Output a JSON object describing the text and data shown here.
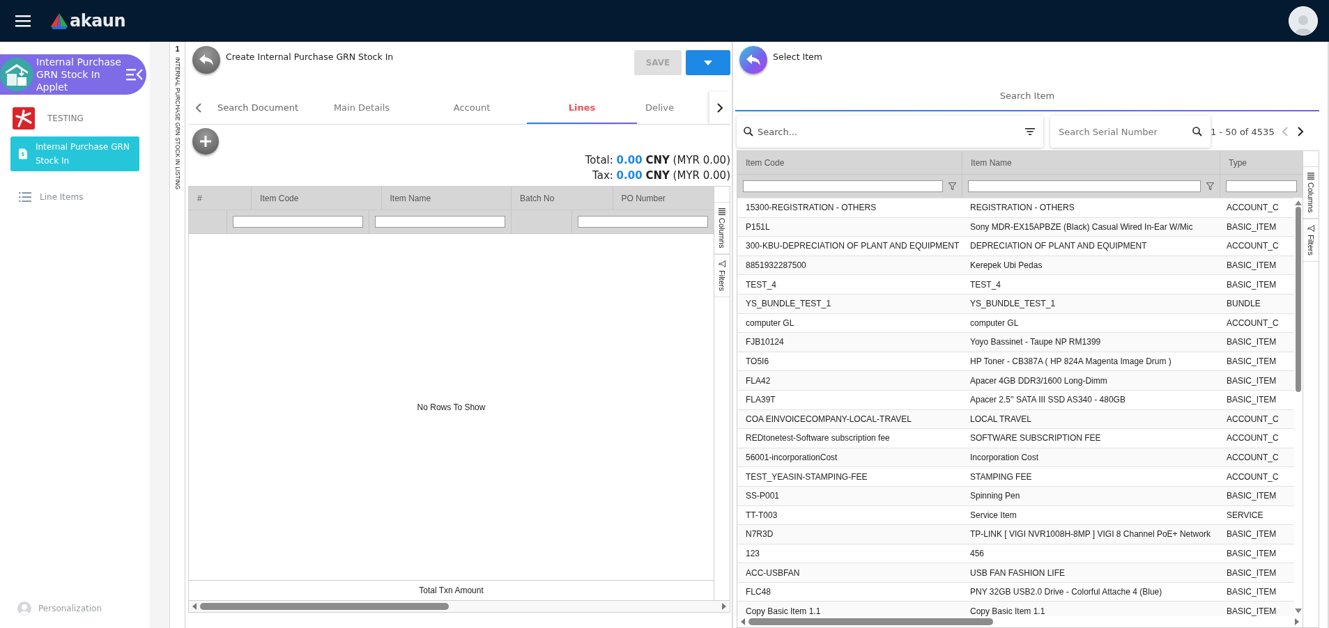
{
  "top_bar": {
    "logo_text": "akaun"
  },
  "sidebar": {
    "applet_title": "Internal Purchase GRN Stock In Applet",
    "org": "TESTING",
    "items": [
      {
        "label": "Internal Purchase GRN Stock In",
        "kind": "page",
        "selected": true
      },
      {
        "label": "Line Items",
        "kind": "list",
        "selected": false
      }
    ],
    "footer": "Personalization"
  },
  "listing_tab": {
    "count": "1",
    "label": "INTERNAL PURCHASE GRN STOCK IN LISTING"
  },
  "form_panel": {
    "title": "Create Internal Purchase GRN Stock In",
    "save_button": {
      "label": "SAVE",
      "disabled": true
    },
    "tabs": [
      {
        "label": "Search Document",
        "selected": false
      },
      {
        "label": "Main Details",
        "selected": false
      },
      {
        "label": "Account",
        "selected": false
      },
      {
        "label": "Lines",
        "selected": true
      },
      {
        "label": "Delive",
        "selected": false
      }
    ],
    "totals": [
      {
        "label": "Total:",
        "amount": "0.00",
        "currency": "CNY",
        "base": "(MYR 0.00)"
      },
      {
        "label": "Tax:",
        "amount": "0.00",
        "currency": "CNY",
        "base": "(MYR 0.00)"
      }
    ],
    "grid": {
      "columns": [
        {
          "label": "#",
          "kind": "plain"
        },
        {
          "label": "Item Code",
          "kind": "filter"
        },
        {
          "label": "Item Name",
          "kind": "filter"
        },
        {
          "label": "Batch No",
          "kind": "plain"
        },
        {
          "label": "PO Number",
          "kind": "filter"
        }
      ],
      "empty_message": "No Rows To Show",
      "footer": "Total Txn Amount",
      "side_buttons": [
        {
          "label": "Columns",
          "kind": "columns"
        },
        {
          "label": "Filters",
          "kind": "filters"
        }
      ]
    }
  },
  "item_panel": {
    "title": "Select Item",
    "tabs": [
      {
        "label": "Search Item",
        "selected": true
      }
    ],
    "search": {
      "placeholder": "Search..."
    },
    "serial_search": {
      "placeholder": "Search Serial Number"
    },
    "pagination": "1 - 50 of 4535",
    "grid": {
      "columns": [
        {
          "label": "Item Code",
          "kind": "filter"
        },
        {
          "label": "Item Name",
          "kind": "filter"
        },
        {
          "label": "Type",
          "kind": "filter"
        }
      ],
      "rows": [
        [
          "15300-REGISTRATION - OTHERS",
          "REGISTRATION - OTHERS",
          "ACCOUNT_C"
        ],
        [
          "P151L",
          "Sony MDR-EX15APBZE (Black) Casual Wired In-Ear W/Mic",
          "BASIC_ITEM"
        ],
        [
          "300-KBU-DEPRECIATION OF PLANT AND EQUIPMENT",
          "DEPRECIATION OF PLANT AND EQUIPMENT",
          "ACCOUNT_C"
        ],
        [
          "8851932287500",
          "Kerepek Ubi Pedas",
          "BASIC_ITEM"
        ],
        [
          "TEST_4",
          "TEST_4",
          "BASIC_ITEM"
        ],
        [
          "YS_BUNDLE_TEST_1",
          "YS_BUNDLE_TEST_1",
          "BUNDLE"
        ],
        [
          "computer GL",
          "computer GL",
          "ACCOUNT_C"
        ],
        [
          "FJB10124",
          "Yoyo Bassinet - Taupe NP RM1399",
          "BASIC_ITEM"
        ],
        [
          "TO5I6",
          "HP Toner - CB387A ( HP 824A Magenta Image Drum )",
          "BASIC_ITEM"
        ],
        [
          "FLA42",
          "Apacer 4GB DDR3/1600 Long-Dimm",
          "BASIC_ITEM"
        ],
        [
          "FLA39T",
          "Apacer 2.5'' SATA III SSD AS340 - 480GB",
          "BASIC_ITEM"
        ],
        [
          "COA EINVOICECOMPANY-LOCAL-TRAVEL",
          "LOCAL TRAVEL",
          "ACCOUNT_C"
        ],
        [
          "REDtonetest-Software subscription fee",
          "SOFTWARE SUBSCRIPTION FEE",
          "ACCOUNT_C"
        ],
        [
          "56001-incorporationCost",
          "Incorporation Cost",
          "ACCOUNT_C"
        ],
        [
          "TEST_YEASIN-STAMPING-FEE",
          "STAMPING FEE",
          "ACCOUNT_C"
        ],
        [
          "SS-P001",
          "Spinning Pen",
          "BASIC_ITEM"
        ],
        [
          "TT-T003",
          "Service Item",
          "SERVICE"
        ],
        [
          "N7R3D",
          "TP-LINK [ VIGI NVR1008H-8MP ] VIGI 8 Channel PoE+ Network",
          "BASIC_ITEM"
        ],
        [
          "123",
          "456",
          "BASIC_ITEM"
        ],
        [
          "ACC-USBFAN",
          "USB FAN FASHION LIFE",
          "BASIC_ITEM"
        ],
        [
          "FLC48",
          "PNY 32GB USB2.0 Drive - Colorful Attache 4 (Blue)",
          "BASIC_ITEM"
        ],
        [
          "Copy Basic Item 1.1",
          "Copy Basic Item 1.1",
          "BASIC_ITEM"
        ]
      ],
      "side_buttons": [
        {
          "label": "Columns",
          "kind": "columns"
        },
        {
          "label": "Filters",
          "kind": "filters"
        }
      ]
    }
  }
}
